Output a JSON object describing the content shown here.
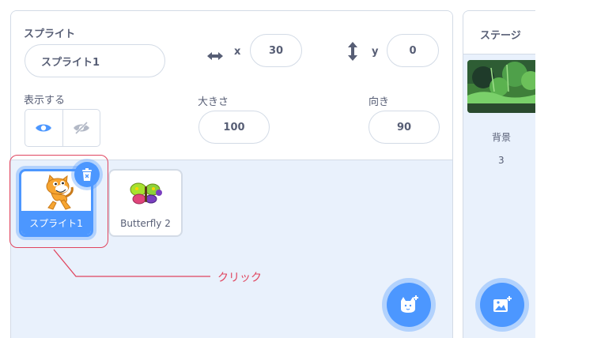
{
  "sprite_info": {
    "sprite_label": "スプライト",
    "sprite_name": "スプライト1",
    "x_label": "x",
    "x_value": "30",
    "y_label": "y",
    "y_value": "0",
    "show_label": "表示する",
    "size_label": "大きさ",
    "size_value": "100",
    "direction_label": "向き",
    "direction_value": "90",
    "visible": true
  },
  "sprites": [
    {
      "name": "スプライト1",
      "selected": true
    },
    {
      "name": "Butterfly 2",
      "selected": false
    }
  ],
  "annotation": {
    "text": "クリック",
    "color": "#e0455f"
  },
  "stage": {
    "title": "ステージ",
    "backdrop_label": "背景",
    "backdrop_count": "3"
  },
  "colors": {
    "accent": "#4c97ff",
    "panel": "#e9f1fc",
    "text": "#575e75"
  },
  "icons": {
    "add_sprite": "cat-add-icon",
    "add_backdrop": "image-add-icon",
    "delete": "trash-icon",
    "show": "eye-icon",
    "hide": "eye-slash-icon"
  }
}
